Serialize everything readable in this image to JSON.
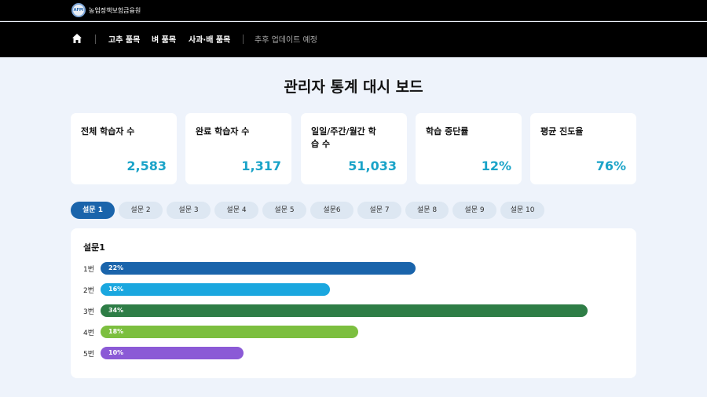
{
  "header": {
    "org_name": "농업정책보험금융원",
    "logo_text": "AFPI"
  },
  "nav": {
    "items": [
      "고추 품목",
      "벼 품목",
      "사과·배 품목"
    ],
    "note": "추후 업데이트 예정",
    "home_icon": "home-icon"
  },
  "page": {
    "title": "관리자 통계 대시 보드"
  },
  "stats": [
    {
      "label": "전체 학습자 수",
      "value": "2,583"
    },
    {
      "label": "완료 학습자 수",
      "value": "1,317"
    },
    {
      "label": "일일/주간/월간 학습 수",
      "value": "51,033"
    },
    {
      "label": "학습 중단률",
      "value": "12%"
    },
    {
      "label": "평균 진도율",
      "value": "76%"
    }
  ],
  "tabs": [
    "설문 1",
    "설문 2",
    "설문 3",
    "설문 4",
    "설문 5",
    "설문6",
    "설문 7",
    "설문 8",
    "설문 9",
    "설문 10"
  ],
  "active_tab": 0,
  "chart_data": {
    "type": "bar",
    "title": "설문1",
    "categories": [
      "1번",
      "2번",
      "3번",
      "4번",
      "5번"
    ],
    "values": [
      22,
      16,
      34,
      18,
      10
    ],
    "value_labels": [
      "22%",
      "16%",
      "34%",
      "18%",
      "10%"
    ],
    "colors": [
      "#1a64ab",
      "#1aa7df",
      "#2e7d46",
      "#7cbf3f",
      "#8b5ad6"
    ]
  }
}
